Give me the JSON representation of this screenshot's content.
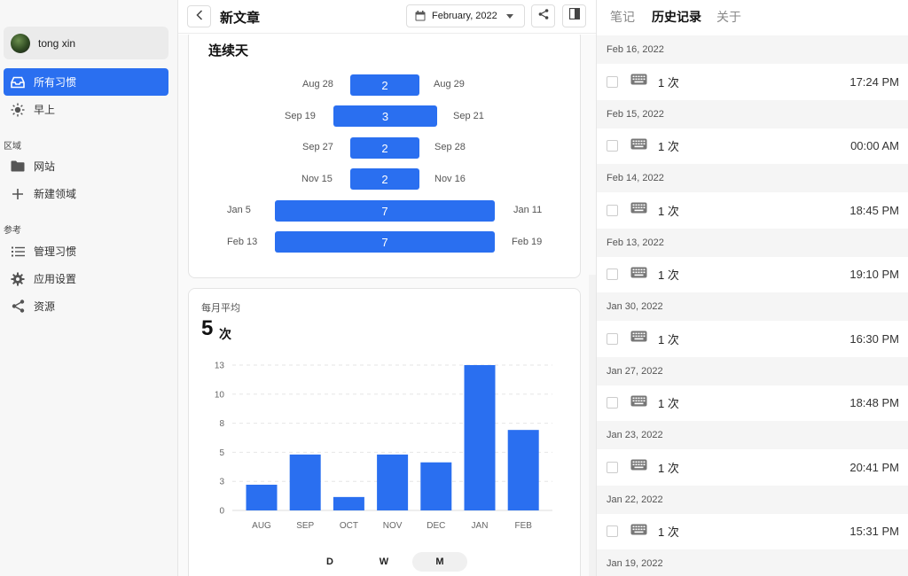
{
  "sidebar": {
    "user_name": "tong xin",
    "items": [
      {
        "label": "所有习惯",
        "active": true
      },
      {
        "label": "早上"
      }
    ],
    "section_area": "区域",
    "area_items": [
      {
        "label": "网站"
      },
      {
        "label": "新建领域"
      }
    ],
    "section_ref": "参考",
    "ref_items": [
      {
        "label": "管理习惯"
      },
      {
        "label": "应用设置"
      },
      {
        "label": "资源"
      }
    ]
  },
  "header": {
    "title": "新文章",
    "date_label": "February, 2022"
  },
  "streaks": {
    "title": "连续天",
    "rows": [
      {
        "start": "Aug 28",
        "end": "Aug 29",
        "days": "2"
      },
      {
        "start": "Sep 19",
        "end": "Sep 21",
        "days": "3"
      },
      {
        "start": "Sep 27",
        "end": "Sep 28",
        "days": "2"
      },
      {
        "start": "Nov 15",
        "end": "Nov 16",
        "days": "2"
      },
      {
        "start": "Jan 5",
        "end": "Jan 11",
        "days": "7"
      },
      {
        "start": "Feb 13",
        "end": "Feb 19",
        "days": "7"
      }
    ]
  },
  "monthly": {
    "label": "每月平均",
    "value": "5",
    "unit": "次",
    "periods": [
      "D",
      "W",
      "M"
    ],
    "active_period": "M"
  },
  "chart_data": {
    "type": "bar",
    "categories": [
      "AUG",
      "SEP",
      "OCT",
      "NOV",
      "DEC",
      "JAN",
      "FEB"
    ],
    "values": [
      2.3,
      5,
      1.2,
      5,
      4.3,
      13,
      7.2
    ],
    "yticks": [
      "0",
      "3",
      "5",
      "8",
      "10",
      "13"
    ],
    "ytick_values": [
      0,
      2.6,
      5.2,
      7.8,
      10.4,
      13
    ],
    "ylim": [
      0,
      13
    ],
    "grid": true,
    "bar_color": "#2a6ff0",
    "title": "",
    "xlabel": "",
    "ylabel": ""
  },
  "right_panel": {
    "tabs": [
      "笔记",
      "历史记录",
      "关于"
    ],
    "active_tab": "历史记录",
    "history": [
      {
        "date": "Feb 16, 2022",
        "count": "1 次",
        "time": "17:24 PM"
      },
      {
        "date": "Feb 15, 2022",
        "count": "1 次",
        "time": "00:00 AM"
      },
      {
        "date": "Feb 14, 2022",
        "count": "1 次",
        "time": "18:45 PM"
      },
      {
        "date": "Feb 13, 2022",
        "count": "1 次",
        "time": "19:10 PM"
      },
      {
        "date": "Jan 30, 2022",
        "count": "1 次",
        "time": "16:30 PM"
      },
      {
        "date": "Jan 27, 2022",
        "count": "1 次",
        "time": "18:48 PM"
      },
      {
        "date": "Jan 23, 2022",
        "count": "1 次",
        "time": "20:41 PM"
      },
      {
        "date": "Jan 22, 2022",
        "count": "1 次",
        "time": "15:31 PM"
      },
      {
        "date": "Jan 19, 2022",
        "count": "",
        "time": ""
      }
    ]
  },
  "colors": {
    "accent": "#2a6ff0",
    "sidebar_bg": "#f7f7f7",
    "date_row_bg": "#f5f5f5"
  }
}
